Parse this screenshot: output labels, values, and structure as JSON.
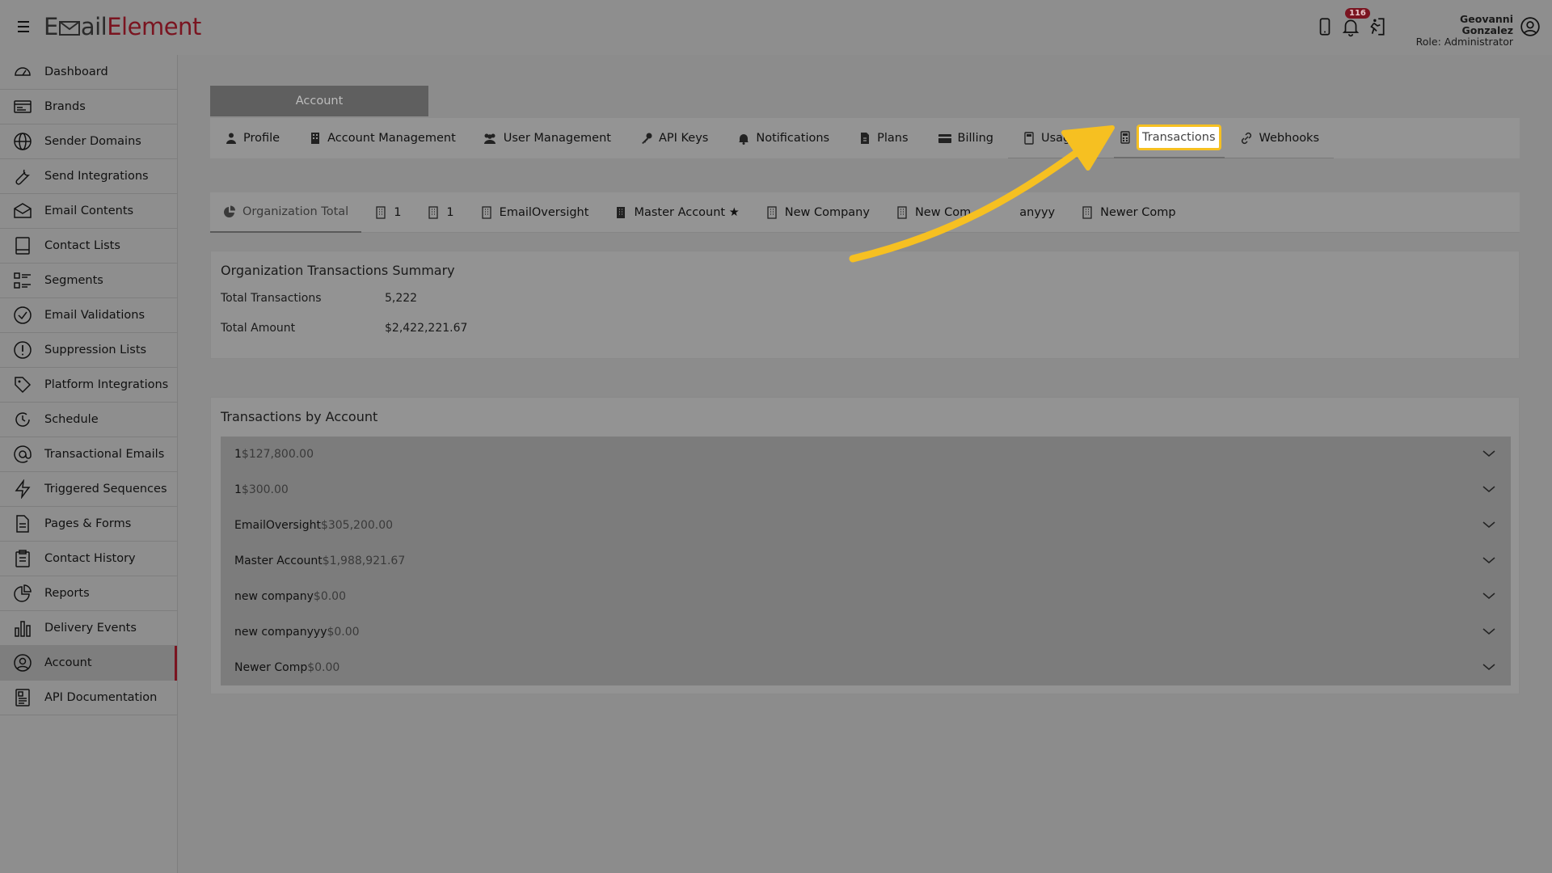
{
  "app": {
    "logo_part1": "E",
    "logo_part2": "ail",
    "logo_part3": "Element",
    "notification_count": "116",
    "user_name": "Geovanni Gonzalez",
    "user_role": "Role: Administrator"
  },
  "sidebar": {
    "items": [
      {
        "label": "Dashboard",
        "icon": "dashboard-icon"
      },
      {
        "label": "Brands",
        "icon": "brands-icon"
      },
      {
        "label": "Sender Domains",
        "icon": "globe-icon"
      },
      {
        "label": "Send Integrations",
        "icon": "wrench-icon"
      },
      {
        "label": "Email Contents",
        "icon": "envelope-icon"
      },
      {
        "label": "Contact Lists",
        "icon": "book-icon"
      },
      {
        "label": "Segments",
        "icon": "segments-icon"
      },
      {
        "label": "Email Validations",
        "icon": "check-circle-icon"
      },
      {
        "label": "Suppression Lists",
        "icon": "alert-circle-icon"
      },
      {
        "label": "Platform Integrations",
        "icon": "tag-icon"
      },
      {
        "label": "Schedule",
        "icon": "clock-icon"
      },
      {
        "label": "Transactional Emails",
        "icon": "at-icon"
      },
      {
        "label": "Triggered Sequences",
        "icon": "bolt-icon"
      },
      {
        "label": "Pages & Forms",
        "icon": "document-icon"
      },
      {
        "label": "Contact History",
        "icon": "clipboard-icon"
      },
      {
        "label": "Reports",
        "icon": "pie-icon"
      },
      {
        "label": "Delivery Events",
        "icon": "bar-chart-icon"
      },
      {
        "label": "Account",
        "icon": "user-circle-icon"
      },
      {
        "label": "API Documentation",
        "icon": "api-doc-icon"
      }
    ]
  },
  "main": {
    "section_tab": "Account",
    "tabs": [
      {
        "label": "Profile"
      },
      {
        "label": "Account Management"
      },
      {
        "label": "User Management"
      },
      {
        "label": "API Keys"
      },
      {
        "label": "Notifications"
      },
      {
        "label": "Plans"
      },
      {
        "label": "Billing"
      },
      {
        "label": "Usage Rep"
      },
      {
        "label": "Transactions"
      },
      {
        "label": "Webhooks"
      }
    ],
    "subtabs": [
      {
        "label": "Organization Total"
      },
      {
        "label": "1"
      },
      {
        "label": "1"
      },
      {
        "label": "EmailOversight"
      },
      {
        "label": "Master Account ★"
      },
      {
        "label": "New Company"
      },
      {
        "label": "New Com"
      },
      {
        "label": "anyyy"
      },
      {
        "label": "Newer Comp"
      }
    ],
    "summary": {
      "title": "Organization Transactions Summary",
      "total_transactions_label": "Total Transactions",
      "total_transactions_value": "5,222",
      "total_amount_label": "Total Amount",
      "total_amount_value": "$2,422,221.67"
    },
    "by_account": {
      "title": "Transactions by Account",
      "rows": [
        {
          "name": "1",
          "amount": "$127,800.00"
        },
        {
          "name": "1",
          "amount": "$300.00"
        },
        {
          "name": "EmailOversight",
          "amount": "$305,200.00"
        },
        {
          "name": "Master Account",
          "amount": "$1,988,921.67"
        },
        {
          "name": "new company",
          "amount": "$0.00"
        },
        {
          "name": "new companyyy",
          "amount": "$0.00"
        },
        {
          "name": "Newer Comp",
          "amount": "$0.00"
        }
      ]
    }
  },
  "colors": {
    "brand": "#7a1420",
    "highlight": "#f6c021",
    "arrow": "#f6c021"
  }
}
